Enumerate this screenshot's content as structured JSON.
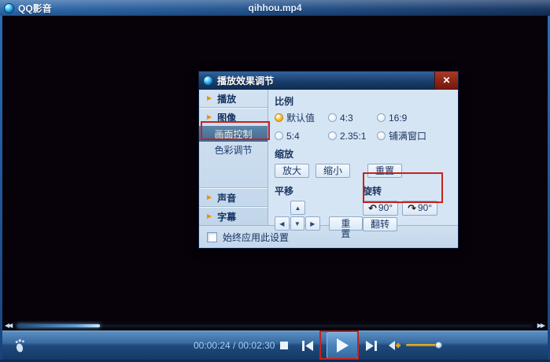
{
  "titlebar": {
    "app_title": "QQ影音",
    "file_title": "qihhou.mp4"
  },
  "dialog": {
    "title": "播放效果调节",
    "close_glyph": "✕",
    "sidebar": {
      "items": [
        {
          "label": "播放",
          "type": "group"
        },
        {
          "label": "图像",
          "type": "group"
        },
        {
          "label": "画面控制",
          "type": "sub",
          "selected": true
        },
        {
          "label": "色彩调节",
          "type": "sub",
          "selected": false
        },
        {
          "label": "声音",
          "type": "group"
        },
        {
          "label": "字幕",
          "type": "group"
        }
      ]
    },
    "ratio": {
      "label": "比例",
      "options": [
        {
          "label": "默认值",
          "selected": true
        },
        {
          "label": "4:3",
          "selected": false
        },
        {
          "label": "16:9",
          "selected": false
        },
        {
          "label": "5:4",
          "selected": false
        },
        {
          "label": "2.35:1",
          "selected": false
        },
        {
          "label": "铺满窗口",
          "selected": false
        }
      ]
    },
    "zoom": {
      "label": "缩放",
      "in": "放大",
      "out": "缩小",
      "reset": "重置"
    },
    "pan": {
      "label": "平移",
      "reset": "重置"
    },
    "rotate": {
      "label": "旋转",
      "ccw_degrees": "90°",
      "cw_degrees": "90°",
      "flip": "翻转"
    },
    "footer": {
      "checkbox_label": "始终应用此设置",
      "checked": false
    }
  },
  "controls": {
    "time": "00:00:24 / 00:02:30",
    "progress_percent": 16,
    "volume_percent": 100
  },
  "icons": {
    "bullet": "▶",
    "up": "▲",
    "down": "▼",
    "left": "◀",
    "right": "▶",
    "rotate_ccw": "↶",
    "rotate_cw": "↷",
    "rewind": "◀◀",
    "forward": "▶▶"
  },
  "colors": {
    "annotation": "#c5231d",
    "accent_orange": "#f0a000",
    "selected_radio": "#f59b00"
  }
}
